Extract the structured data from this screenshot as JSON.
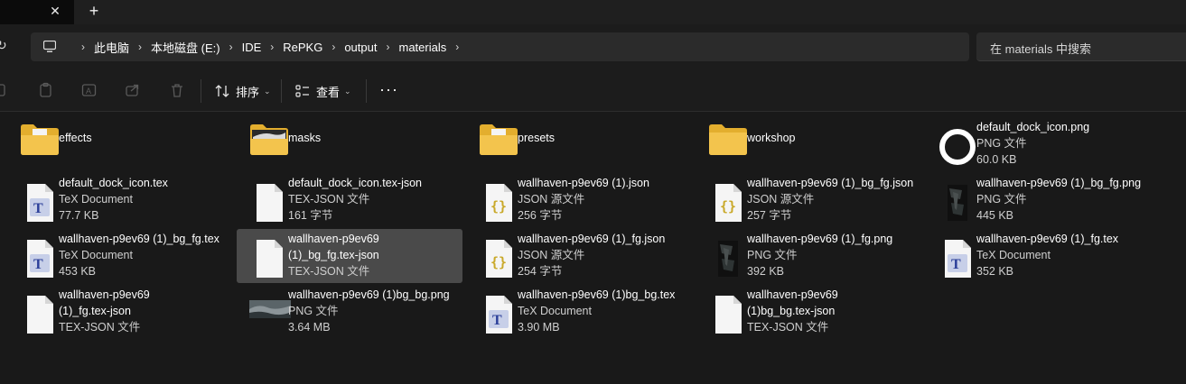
{
  "tabbar": {
    "close_glyph": "✕",
    "new_tab_glyph": "+"
  },
  "address": {
    "refresh_glyph": "↻",
    "separator": "›",
    "crumbs": [
      "此电脑",
      "本地磁盘 (E:)",
      "IDE",
      "RePKG",
      "output",
      "materials"
    ]
  },
  "search": {
    "placeholder": "在 materials 中搜索"
  },
  "toolbar": {
    "sort_label": "排序",
    "view_label": "查看",
    "more_glyph": "···",
    "chevron": "⌄"
  },
  "items": [
    {
      "kind": "folder",
      "name": "effects",
      "icon": "folder-doc-icon"
    },
    {
      "kind": "folder",
      "name": "masks",
      "icon": "folder-image-icon"
    },
    {
      "kind": "folder",
      "name": "presets",
      "icon": "folder-doc-icon"
    },
    {
      "kind": "folder",
      "name": "workshop",
      "icon": "folder-icon"
    },
    {
      "kind": "file",
      "name": "default_dock_icon.png",
      "type": "PNG 文件",
      "size": "60.0 KB",
      "icon": "ring-png-icon"
    },
    {
      "kind": "file",
      "name": "default_dock_icon.tex",
      "type": "TeX Document",
      "size": "77.7 KB",
      "icon": "tex-icon"
    },
    {
      "kind": "file",
      "name": "default_dock_icon.tex-json",
      "type": "TEX-JSON 文件",
      "size": "161 字节",
      "icon": "blank-file-icon"
    },
    {
      "kind": "file",
      "name": "wallhaven-p9ev69 (1).json",
      "type": "JSON 源文件",
      "size": "256 字节",
      "icon": "json-icon"
    },
    {
      "kind": "file",
      "name": "wallhaven-p9ev69 (1)_bg_fg.json",
      "type": "JSON 源文件",
      "size": "257 字节",
      "icon": "json-icon"
    },
    {
      "kind": "file",
      "name": "wallhaven-p9ev69 (1)_bg_fg.png",
      "type": "PNG 文件",
      "size": "445 KB",
      "icon": "dark-png-icon"
    },
    {
      "kind": "file",
      "name": "wallhaven-p9ev69 (1)_bg_fg.tex",
      "type": "TeX Document",
      "size": "453 KB",
      "icon": "tex-icon"
    },
    {
      "kind": "file",
      "name_lines": [
        "wallhaven-p9ev69",
        "(1)_bg_fg.tex-json"
      ],
      "type": "TEX-JSON 文件",
      "size": "",
      "icon": "blank-file-icon",
      "selected": true
    },
    {
      "kind": "file",
      "name": "wallhaven-p9ev69 (1)_fg.json",
      "type": "JSON 源文件",
      "size": "254 字节",
      "icon": "json-icon"
    },
    {
      "kind": "file",
      "name": "wallhaven-p9ev69 (1)_fg.png",
      "type": "PNG 文件",
      "size": "392 KB",
      "icon": "dark-png-icon"
    },
    {
      "kind": "file",
      "name": "wallhaven-p9ev69 (1)_fg.tex",
      "type": "TeX Document",
      "size": "352 KB",
      "icon": "tex-icon"
    },
    {
      "kind": "file",
      "name_lines": [
        "wallhaven-p9ev69",
        "(1)_fg.tex-json"
      ],
      "type": "TEX-JSON 文件",
      "size": "",
      "icon": "blank-file-icon"
    },
    {
      "kind": "file",
      "name": "wallhaven-p9ev69 (1)bg_bg.png",
      "type": "PNG 文件",
      "size": "3.64 MB",
      "icon": "wide-png-icon"
    },
    {
      "kind": "file",
      "name": "wallhaven-p9ev69 (1)bg_bg.tex",
      "type": "TeX Document",
      "size": "3.90 MB",
      "icon": "tex-icon"
    },
    {
      "kind": "file",
      "name_lines": [
        "wallhaven-p9ev69",
        "(1)bg_bg.tex-json"
      ],
      "type": "TEX-JSON 文件",
      "size": "",
      "icon": "blank-file-icon"
    }
  ],
  "colors": {
    "background": "#191919",
    "selection": "#4a4a4a",
    "folder": "#f3c44d",
    "json_brace": "#c9a92a",
    "tex_blue": "#2b3f99"
  }
}
